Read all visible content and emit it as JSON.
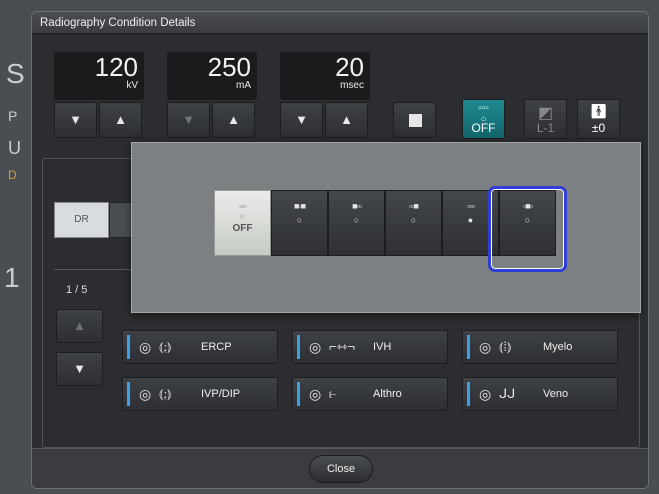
{
  "dialog": {
    "title": "Radiography Condition Details",
    "close_label": "Close"
  },
  "exposure": {
    "kv": {
      "value": "120",
      "unit": "kV"
    },
    "ma": {
      "value": "250",
      "unit": "mA"
    },
    "msec": {
      "value": "20",
      "unit": "msec"
    }
  },
  "modes": {
    "aec": "OFF",
    "density": "L-1",
    "patient": "±0"
  },
  "panel": {
    "dr_label": "DR",
    "page": "1 / 5"
  },
  "protocols": [
    {
      "name": "ERCP"
    },
    {
      "name": "IVH"
    },
    {
      "name": "Myelo"
    },
    {
      "name": "IVP/DIP"
    },
    {
      "name": "Althro"
    },
    {
      "name": "Veno"
    }
  ],
  "popup": {
    "off_label": "OFF"
  },
  "colors": {
    "accent_teal": "#1f8a92",
    "selection": "#2f3fd8",
    "protocol_bar": "#3aa0e8"
  }
}
